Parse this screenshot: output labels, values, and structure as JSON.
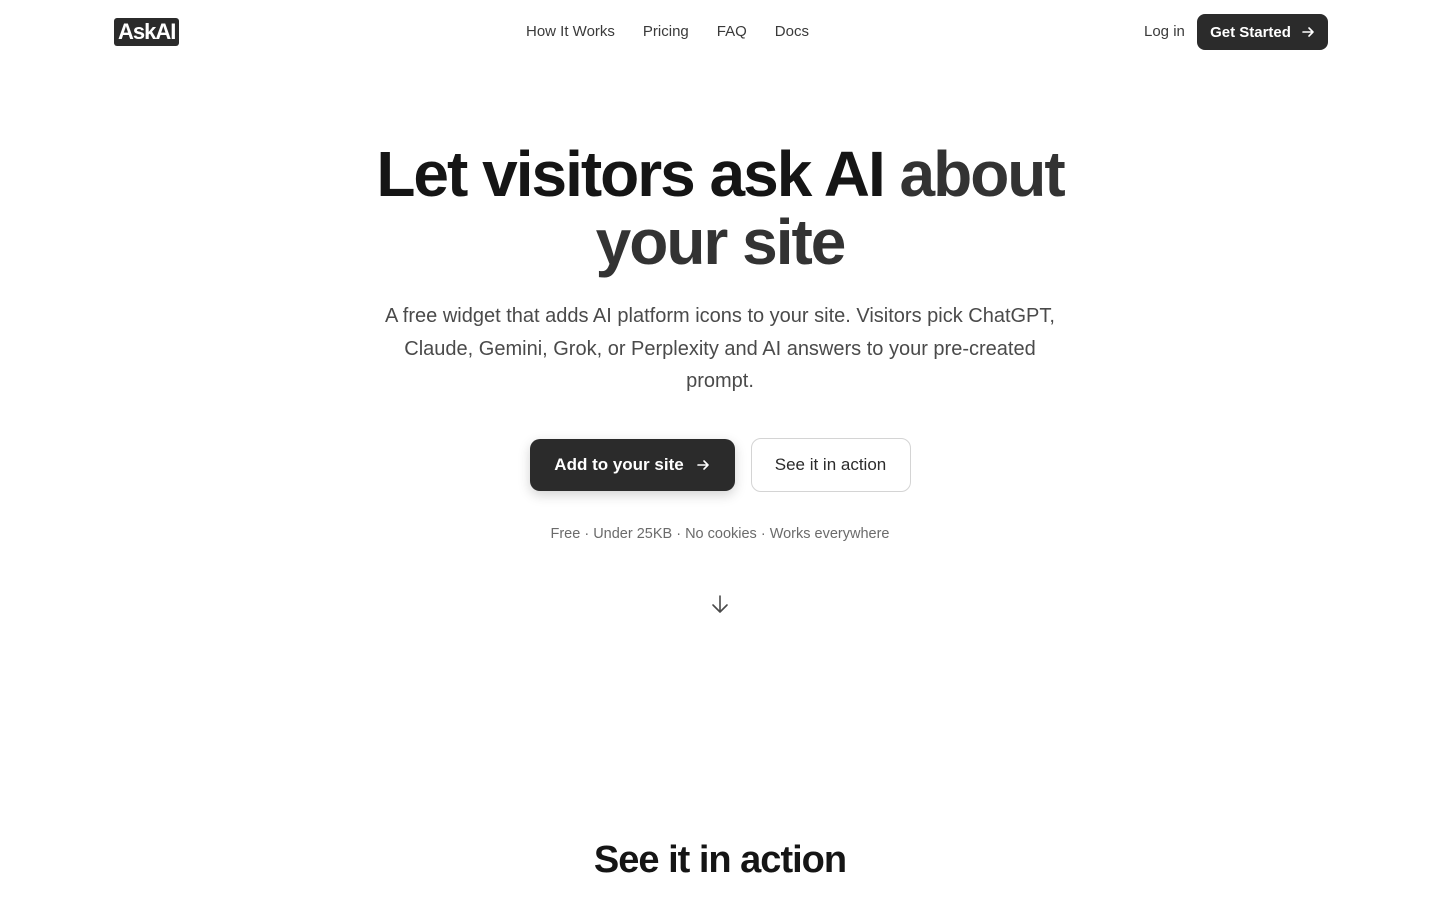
{
  "header": {
    "logo": "AskAI",
    "nav": [
      "How It Works",
      "Pricing",
      "FAQ",
      "Docs"
    ],
    "login_label": "Log in",
    "get_started_label": "Get Started"
  },
  "hero": {
    "title_part1": "Let visitors ask AI ",
    "title_part2": "about your site",
    "subtitle": "A free widget that adds AI platform icons to your site. Visitors pick ChatGPT, Claude, Gemini, Grok, or Perplexity and AI answers to your pre-created prompt.",
    "primary_cta": "Add to your site",
    "secondary_cta": "See it in action",
    "features": "Free · Under 25KB · No cookies · Works everywhere"
  },
  "section": {
    "title": "See it in action"
  },
  "colors": {
    "brand_dark": "#2b2b2b",
    "text_primary": "#151515",
    "text_secondary": "#4a4a4a"
  }
}
